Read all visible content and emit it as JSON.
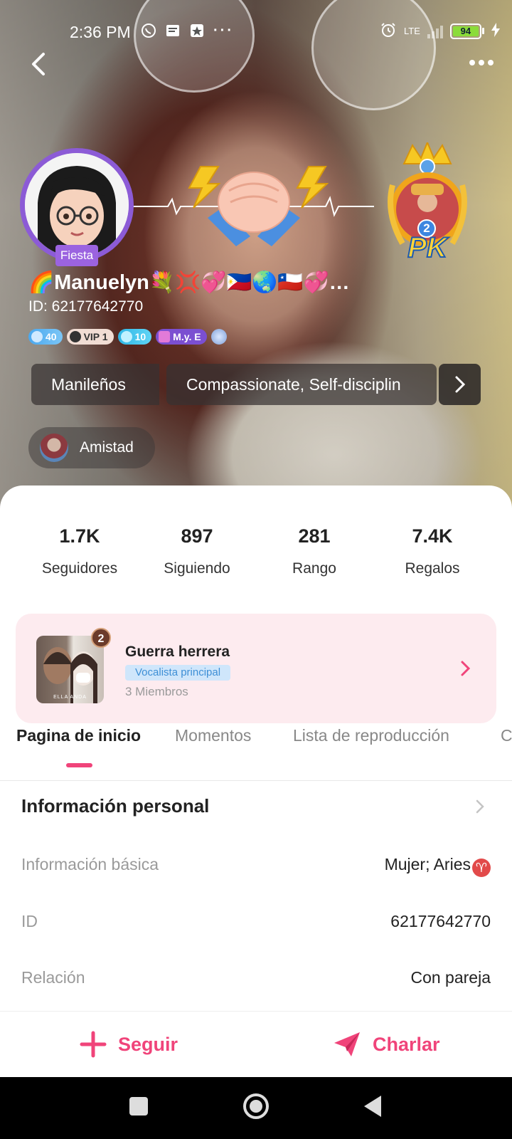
{
  "status_bar": {
    "time": "2:36 PM",
    "icons": [
      "whatsapp-icon",
      "news-icon",
      "star-app-icon",
      "more-dots-icon"
    ],
    "alarm_icon": "alarm-icon",
    "network": "LTE",
    "battery": "94",
    "charging_icon": "bolt-icon"
  },
  "header": {
    "back_icon": "chevron-left-icon",
    "more_icon": "more-horizontal-icon"
  },
  "profile": {
    "avatar_tag": "Fiesta",
    "username": "🌈Manuelyn💐💢💞🇵🇭🌏🇨🇱💞…",
    "id_text": "ID: 62177642770",
    "badges": {
      "level": "40",
      "vip": "VIP 1",
      "gem": "10",
      "family": "M.y. E"
    },
    "pk_rank": "2",
    "pk_label": "PK"
  },
  "tags": [
    "Manileños",
    "Compassionate, Self-disciplin"
  ],
  "friendship": {
    "label": "Amistad"
  },
  "stats": [
    {
      "value": "1.7K",
      "label": "Seguidores"
    },
    {
      "value": "897",
      "label": "Siguiendo"
    },
    {
      "value": "281",
      "label": "Rango"
    },
    {
      "value": "7.4K",
      "label": "Regalos"
    }
  ],
  "family": {
    "name": "Guerra herrera",
    "role": "Vocalista principal",
    "members": "3 Miembros",
    "rank": "2",
    "image_caption": "ELLA ANDA"
  },
  "tabs": [
    "Pagina de inicio",
    "Momentos",
    "Lista de reproducción",
    "C"
  ],
  "personal_info": {
    "title": "Información personal",
    "rows": [
      {
        "key": "Información básica",
        "value": "Mujer; Aries"
      },
      {
        "key": "ID",
        "value": "62177642770"
      },
      {
        "key": "Relación",
        "value": "Con pareja"
      }
    ]
  },
  "actions": {
    "follow": "Seguir",
    "chat": "Charlar"
  },
  "colors": {
    "accent": "#f0447a",
    "card_bg": "#fdebef",
    "avatar_ring": "#8c5bd6"
  }
}
